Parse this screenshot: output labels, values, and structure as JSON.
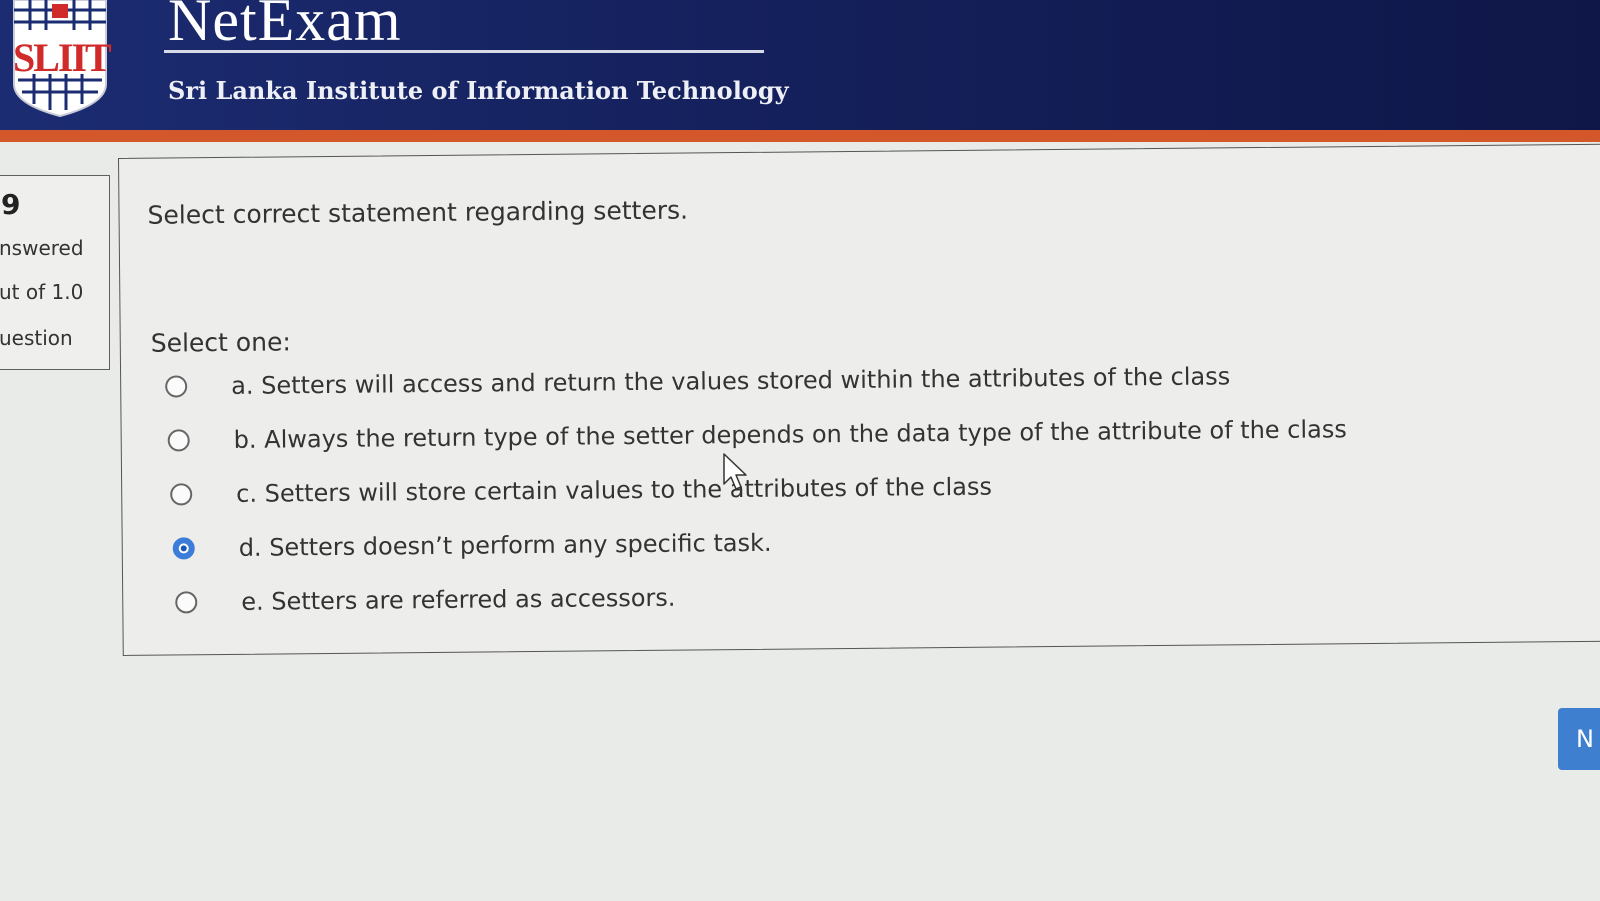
{
  "header": {
    "logo_text": "SLIIT",
    "title": "NetExam",
    "subtitle": "Sri Lanka Institute of Information Technology"
  },
  "question_info": {
    "number": "9",
    "status": "nswered",
    "marks": "ut of 1.0",
    "flag": "uestion"
  },
  "question": {
    "text": "Select correct statement regarding setters.",
    "prompt": "Select one:",
    "options": [
      {
        "label": "a. Setters will access and return the values stored within the attributes of the class",
        "selected": false
      },
      {
        "label": "b. Always the return type of the setter depends on the data type of the attribute of the class",
        "selected": false
      },
      {
        "label": "c. Setters will store certain values to the attributes of the class",
        "selected": false
      },
      {
        "label": "d. Setters doesn’t perform any specific task.",
        "selected": true
      },
      {
        "label": "e. Setters are referred as accessors.",
        "selected": false
      }
    ]
  },
  "navigation": {
    "next_label": "N"
  },
  "colors": {
    "header_bg": "#15215d",
    "accent_stripe": "#d4572b",
    "radio_selected": "#3b7dd8",
    "next_button": "#3f7fcf"
  }
}
